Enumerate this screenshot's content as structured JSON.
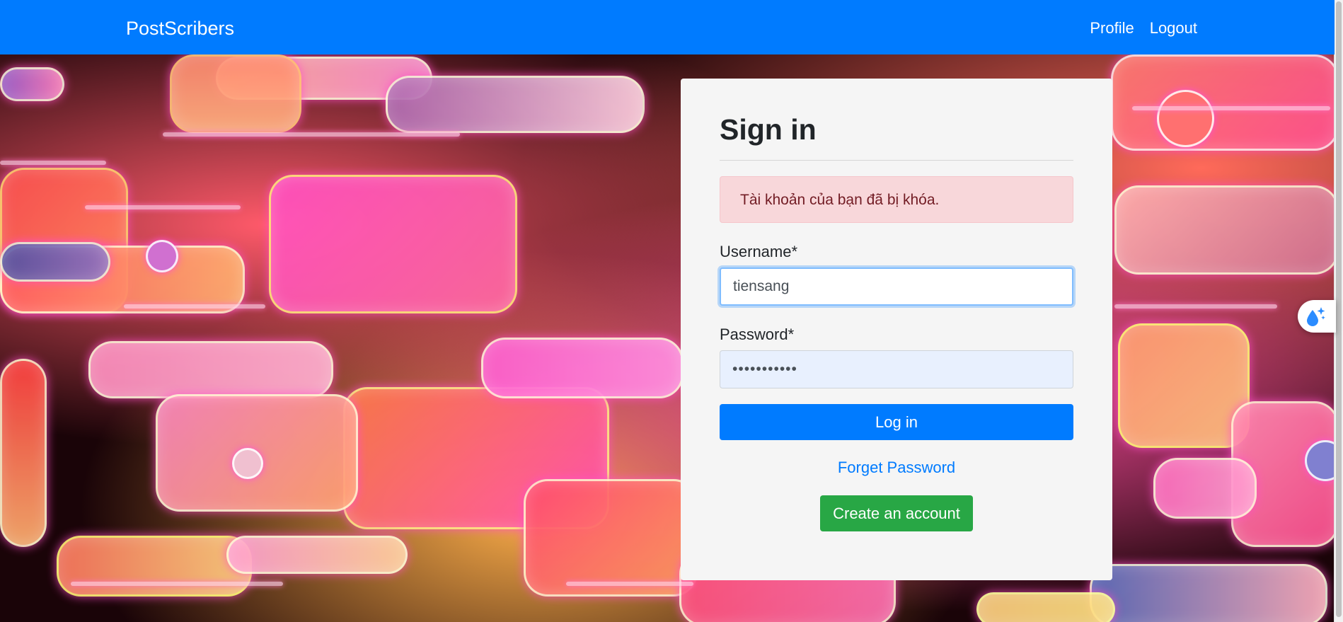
{
  "navbar": {
    "brand": "PostScribers",
    "links": [
      "Profile",
      "Logout"
    ]
  },
  "signin": {
    "title": "Sign in",
    "alert": "Tài khoản của bạn đã bị khóa.",
    "username_label": "Username*",
    "username_value": "tiensang",
    "password_label": "Password*",
    "password_value": "•••••••••••",
    "login_button": "Log in",
    "forget_link": "Forget Password",
    "create_button": "Create an account"
  },
  "widget": {
    "icon": "water-drop-sparkle-icon"
  },
  "colors": {
    "navbar": "#007bff",
    "primary": "#007bff",
    "success": "#28a745",
    "alert_bg": "#f8d7da",
    "alert_text": "#721c24",
    "card_bg": "#f5f5f5"
  }
}
